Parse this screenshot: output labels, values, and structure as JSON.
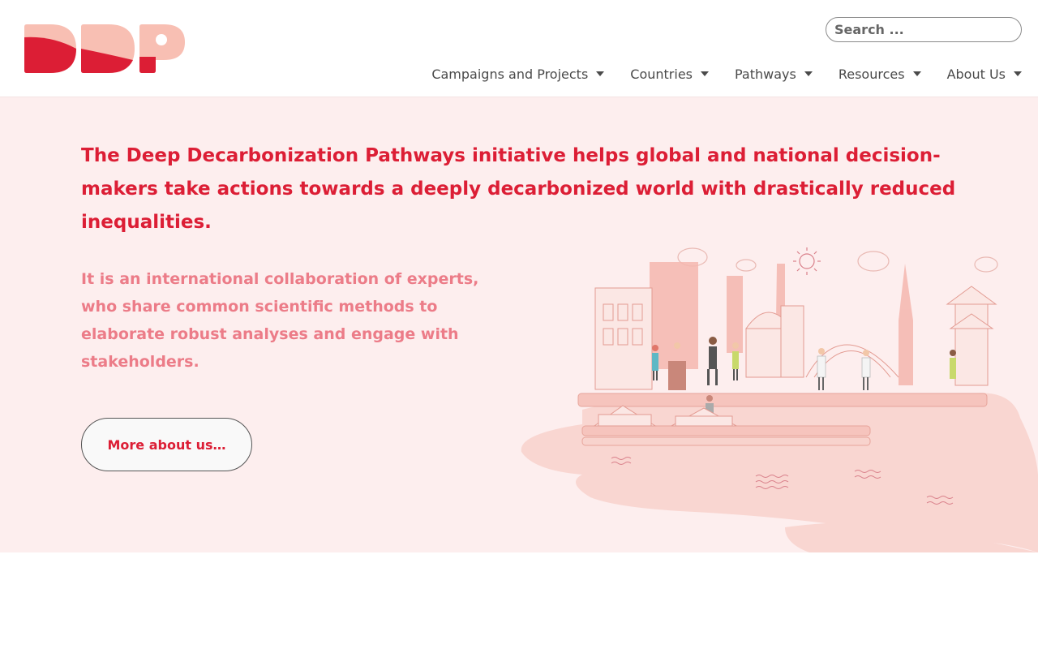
{
  "header": {
    "logo_text": "DDP",
    "search": {
      "placeholder": "Search ..."
    },
    "nav": [
      {
        "label": "Campaigns and Projects"
      },
      {
        "label": "Countries"
      },
      {
        "label": "Pathways"
      },
      {
        "label": "Resources"
      },
      {
        "label": "About Us"
      }
    ]
  },
  "hero": {
    "headline": "The Deep Decarbonization Pathways initiative helps global and national decision-makers take actions towards a deeply decarbonized world with drastically reduced inequalities.",
    "intro": "It is an international collaboration of experts, who share common scientific methods to elaborate robust analyses and engage with stakeholders.",
    "cta_label": "More about us…"
  },
  "colors": {
    "brand_red": "#dc1e35",
    "brand_pink": "#f8bfb3",
    "hero_background": "#fdeeee",
    "intro_text": "#ec7c88"
  },
  "icons": {
    "nav_dropdown": "caret-down-icon"
  }
}
